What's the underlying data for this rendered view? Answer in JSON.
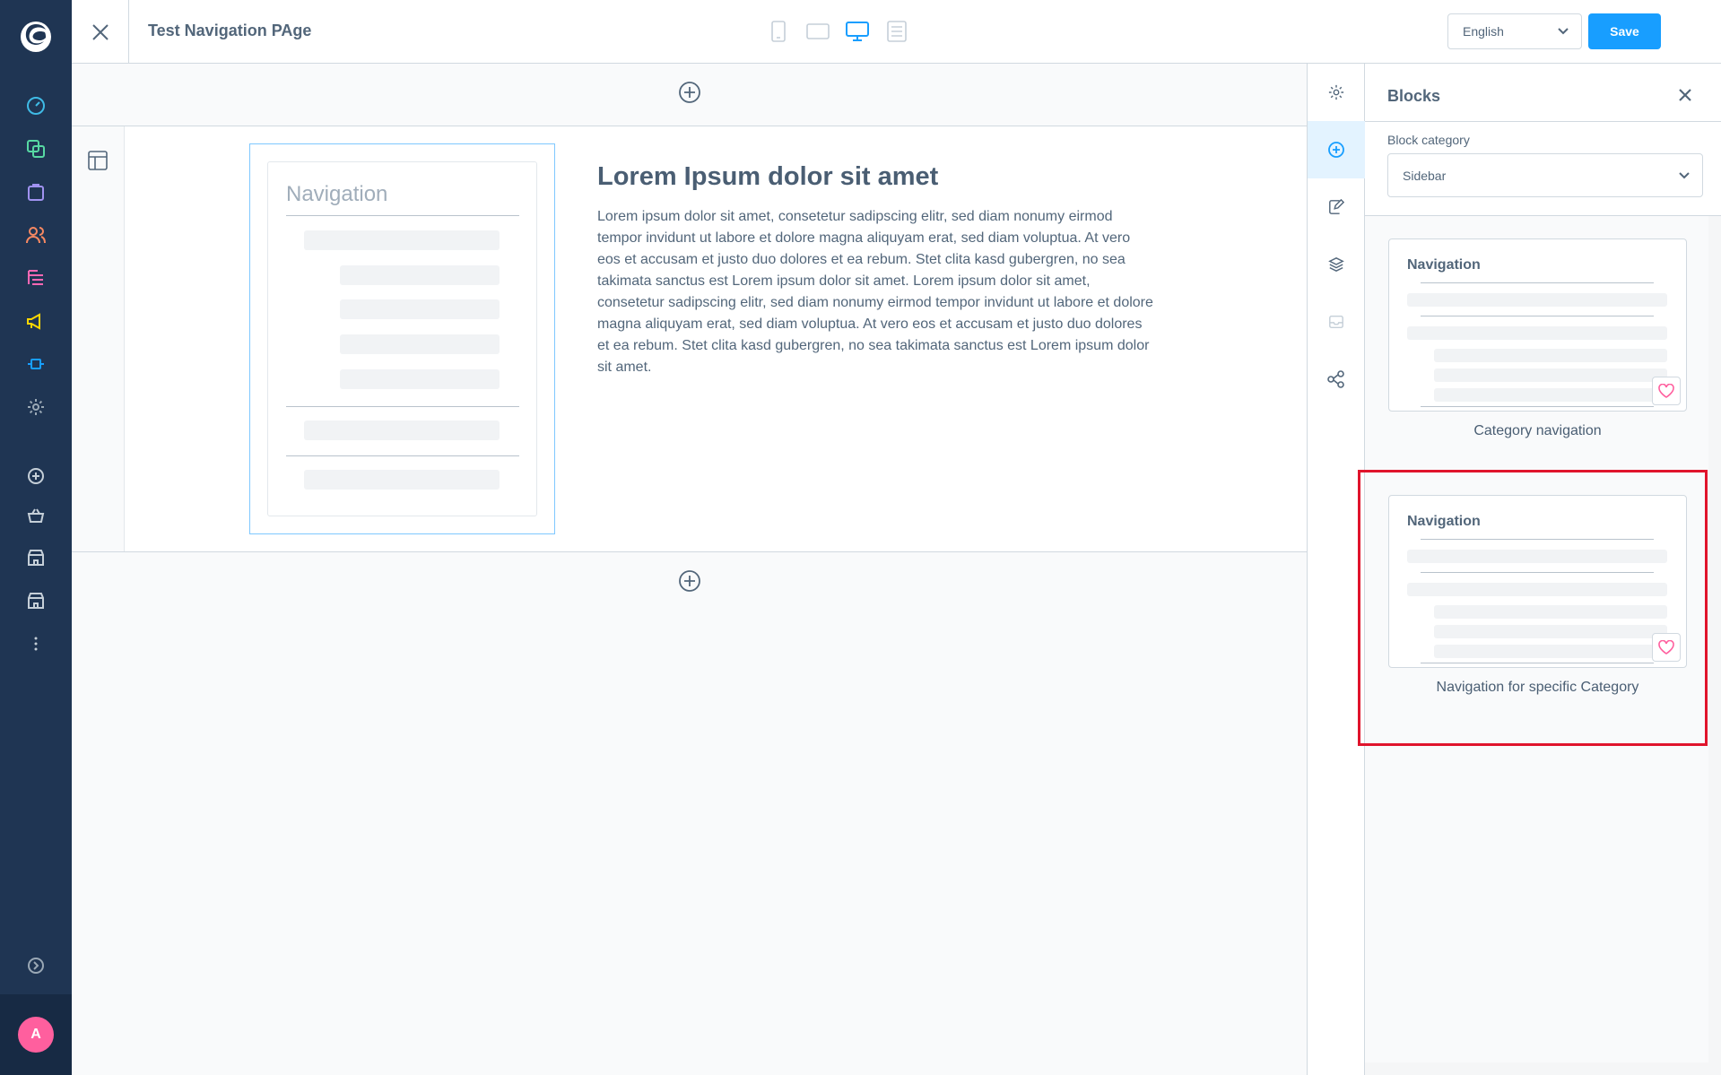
{
  "topbar": {
    "page_title": "Test Navigation PAge",
    "language": "English",
    "save_label": "Save",
    "devices": [
      "mobile-icon",
      "tablet-icon",
      "desktop-icon",
      "list-view-icon"
    ]
  },
  "canvas": {
    "nav_block": {
      "title": "Navigation"
    },
    "text_block": {
      "heading": "Lorem Ipsum dolor sit amet",
      "body": "Lorem ipsum dolor sit amet, consetetur sadipscing elitr, sed diam nonumy eirmod tempor invidunt ut labore et dolore magna aliquyam erat, sed diam voluptua. At vero eos et accusam et justo duo dolores et ea rebum. Stet clita kasd gubergren, no sea takimata sanctus est Lorem ipsum dolor sit amet. Lorem ipsum dolor sit amet, consetetur sadipscing elitr, sed diam nonumy eirmod tempor invidunt ut labore et dolore magna aliquyam erat, sed diam voluptua. At vero eos et accusam et justo duo dolores et ea rebum. Stet clita kasd gubergren, no sea takimata sanctus est Lorem ipsum dolor sit amet."
    }
  },
  "blocks_panel": {
    "title": "Blocks",
    "category_label": "Block category",
    "category_value": "Sidebar",
    "cards": [
      {
        "preview_title": "Navigation",
        "label": "Category navigation"
      },
      {
        "preview_title": "Navigation",
        "label": "Navigation for specific Category"
      }
    ]
  },
  "sidebar": {
    "avatar_initial": "A",
    "icons": [
      "dashboard-icon",
      "catalogue-icon",
      "orders-icon",
      "customers-icon",
      "content-icon",
      "marketing-icon",
      "extensions-icon",
      "settings-icon",
      "add-icon",
      "basket-icon",
      "storefront-icon",
      "storefront-2-icon",
      "more-icon"
    ]
  },
  "colors": {
    "sidebar_bg": "#1f3553",
    "accent": "#189eff",
    "highlight": "#e0142c",
    "favorite": "#ff5f9e"
  }
}
